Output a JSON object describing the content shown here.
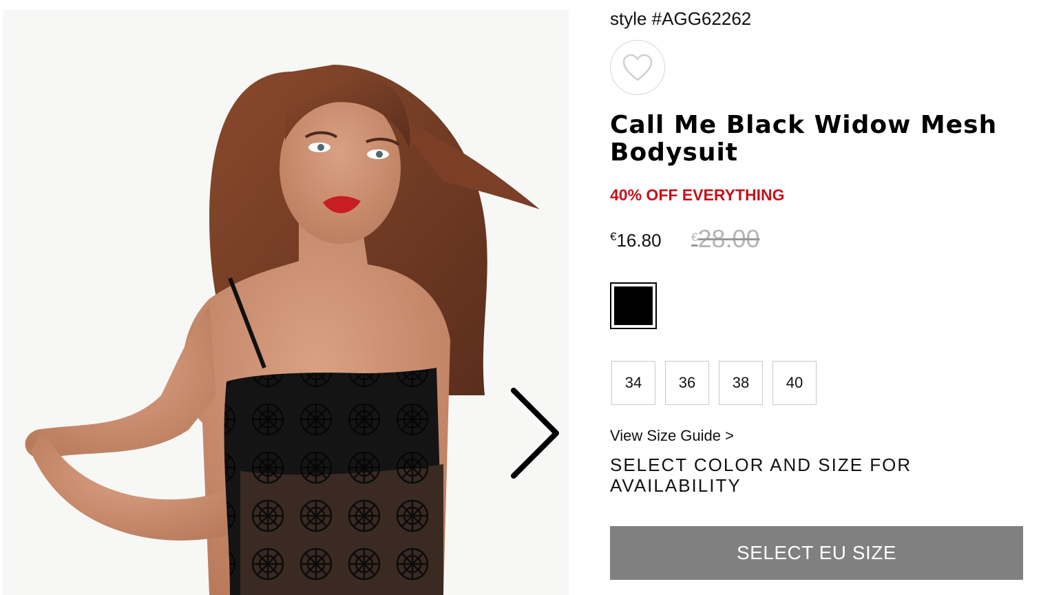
{
  "product": {
    "style_code": "style #AGG62262",
    "title": "Call Me Black Widow Mesh Bodysuit",
    "promo": "40% OFF EVERYTHING",
    "price": {
      "currency": "€",
      "current": "16.80",
      "original": "28.00"
    },
    "colors": [
      {
        "name": "black",
        "hex": "#000000",
        "selected": true
      }
    ],
    "sizes": [
      "34",
      "36",
      "38",
      "40"
    ],
    "size_guide_label": "View Size Guide >",
    "availability_text": "SELECT COLOR AND SIZE FOR AVAILABILITY",
    "cta_label": "SELECT EU SIZE"
  },
  "gallery": {
    "next_icon": "chevron-right-icon",
    "wishlist_icon": "heart-outline-icon"
  },
  "colors": {
    "promo": "#c4121a",
    "cta_background": "#808080",
    "cta_text": "#ffffff",
    "strikethrough_price": "#b4b4b4"
  }
}
